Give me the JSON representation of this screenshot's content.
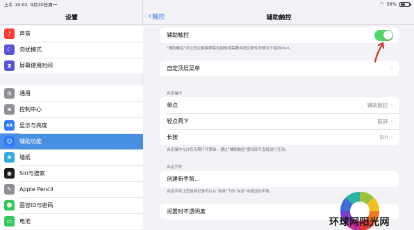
{
  "status_bar": {
    "time": "上午 10:02",
    "date": "9月30日周一",
    "battery": "58%",
    "battery_level": 0.58,
    "wifi_icon": "wifi-icon"
  },
  "sidebar": {
    "title": "设置",
    "group1": [
      {
        "label": "声音",
        "icon": "speaker-icon",
        "color": "#ff3b30",
        "glyph": "♪"
      },
      {
        "label": "勿扰模式",
        "icon": "moon-icon",
        "color": "#5856d6",
        "glyph": "☾"
      },
      {
        "label": "屏幕使用时间",
        "icon": "hourglass-icon",
        "color": "#5856d6",
        "glyph": "⧗"
      }
    ],
    "group2": [
      {
        "label": "通用",
        "icon": "gear-icon",
        "color": "#8e8e93",
        "glyph": "⚙"
      },
      {
        "label": "控制中心",
        "icon": "switches-icon",
        "color": "#8e8e93",
        "glyph": "≡"
      },
      {
        "label": "显示与亮度",
        "icon": "display-icon",
        "color": "#2f7cf6",
        "glyph": "AA"
      },
      {
        "label": "辅助功能",
        "icon": "accessibility-icon",
        "color": "#2f7cf6",
        "glyph": "☺",
        "active": true
      },
      {
        "label": "墙纸",
        "icon": "wallpaper-icon",
        "color": "#34aadc",
        "glyph": "❀"
      },
      {
        "label": "Siri与搜索",
        "icon": "siri-icon",
        "color": "#1c1c1e",
        "glyph": "◉"
      },
      {
        "label": "Apple Pencil",
        "icon": "pencil-icon",
        "color": "#8e8e93",
        "glyph": "✎"
      },
      {
        "label": "面容ID与密码",
        "icon": "faceid-icon",
        "color": "#34c759",
        "glyph": "☻"
      },
      {
        "label": "电池",
        "icon": "battery-icon",
        "color": "#34c759",
        "glyph": "▭"
      }
    ]
  },
  "main": {
    "back_label": "触控",
    "title": "辅助触控",
    "assistive_touch": {
      "label": "辅助触控",
      "enabled": true,
      "note": "\"辅助触控\"可让您在触摸屏幕有困难或需要自适应配件的情况下使用iPad。"
    },
    "customize_menu": "自定顶层菜单",
    "custom_actions_header": "自定操作",
    "actions": [
      {
        "label": "单点",
        "value": "辅助触控"
      },
      {
        "label": "轻点两下",
        "value": "截屏"
      },
      {
        "label": "长按",
        "value": "Siri"
      }
    ],
    "actions_note": "自定操作允许您无需打开菜单，通过\"辅助触控\"图标即可直接进行互动。",
    "custom_gestures_header": "自定手势",
    "create_gesture": "创建新手势...",
    "gestures_note": "自定手势让您能够记录可以从\"菜单\"下的\"自定\"中激活的手势。",
    "idle_opacity": "闲置时不透明度"
  },
  "watermark": {
    "text": "环球网阳光网"
  }
}
